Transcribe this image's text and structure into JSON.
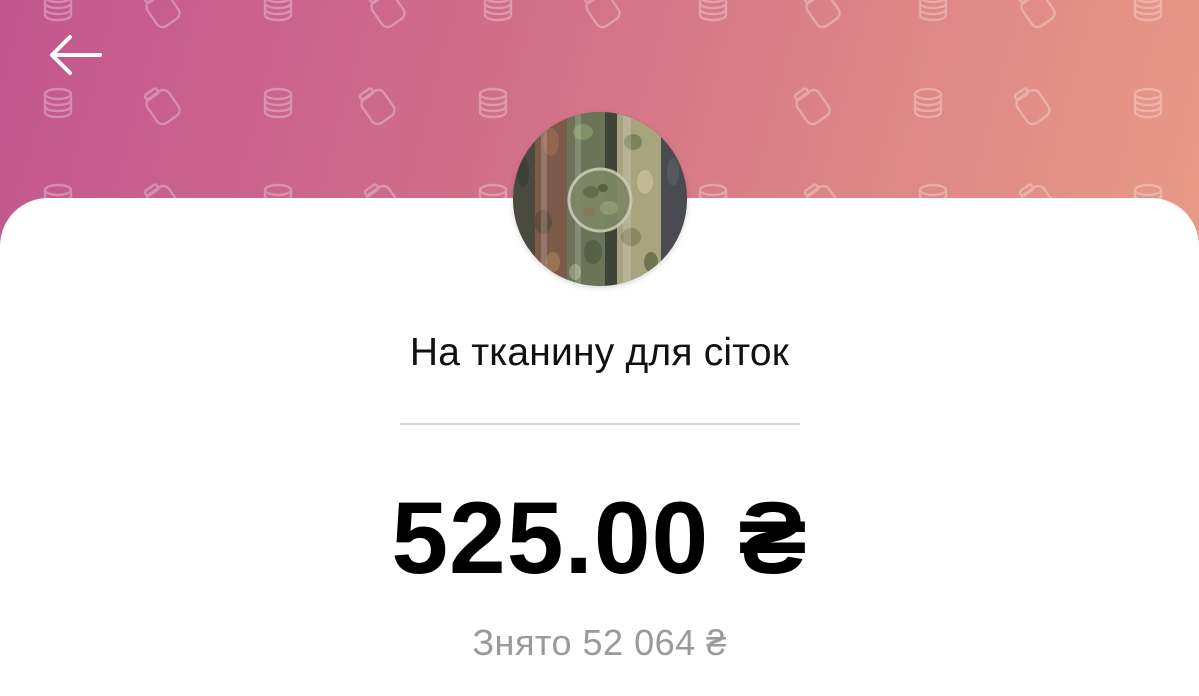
{
  "header": {
    "back_icon": "arrow-left-icon",
    "pattern_icons": [
      "piggy-bank-icon",
      "coins-icon"
    ]
  },
  "jar": {
    "avatar": "camouflage-fabric-image",
    "title": "На тканину для сіток",
    "amount": "525.00 ₴",
    "withdrawn": "Знято 52 064 ₴"
  },
  "colors": {
    "gradient_start": "#c2568e",
    "gradient_end": "#e89a86",
    "amount_text": "#000000",
    "secondary_text": "#9a9a9a"
  }
}
